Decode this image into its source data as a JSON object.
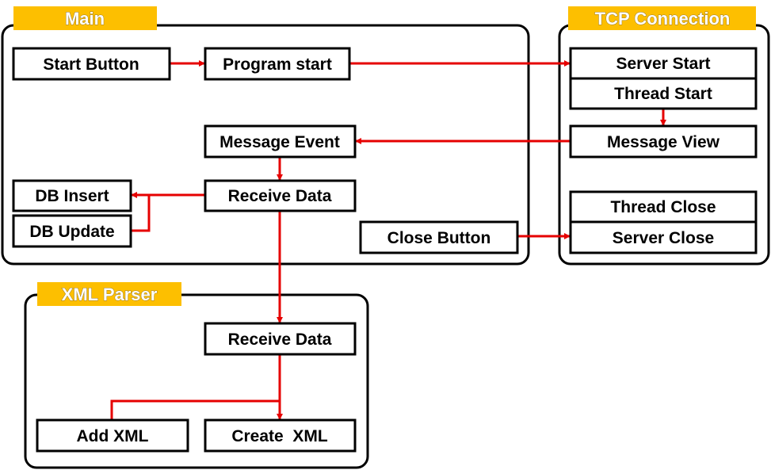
{
  "groups": {
    "main": "Main",
    "tcp": "TCP Connection",
    "xml": "XML Parser"
  },
  "nodes": {
    "start_button": "Start Button",
    "program_start": "Program start",
    "message_event": "Message Event",
    "receive_data_main": "Receive Data",
    "db_insert": "DB Insert",
    "db_update": "DB Update",
    "close_button": "Close Button",
    "server_start": "Server Start",
    "thread_start": "Thread Start",
    "message_view": "Message View",
    "thread_close": "Thread Close",
    "server_close": "Server Close",
    "receive_data_xml": "Receive Data",
    "add_xml": "Add XML",
    "create_xml": "Create  XML"
  },
  "colors": {
    "group_label": "#fdbf00",
    "arrow": "#e60000"
  }
}
